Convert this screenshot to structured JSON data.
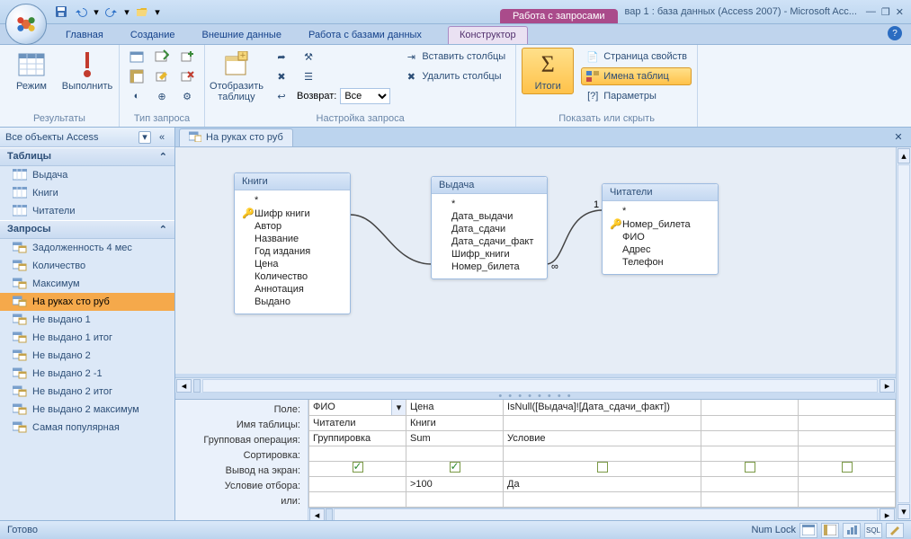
{
  "app": {
    "title": "вар 1 : база данных (Access 2007) - Microsoft Acc...",
    "context_tab": "Работа с запросами"
  },
  "tabs": {
    "home": "Главная",
    "create": "Создание",
    "external": "Внешние данные",
    "dbtools": "Работа с базами данных",
    "designer": "Конструктор"
  },
  "ribbon": {
    "results": {
      "view": "Режим",
      "run": "Выполнить",
      "group": "Результаты"
    },
    "qtype": {
      "group": "Тип запроса"
    },
    "setup": {
      "showtable": "Отобразить\nтаблицу",
      "insert_cols": "Вставить столбцы",
      "delete_cols": "Удалить столбцы",
      "return": "Возврат:",
      "return_val": "Все",
      "group": "Настройка запроса"
    },
    "showhide": {
      "totals": "Итоги",
      "propsheet": "Страница свойств",
      "tablenames": "Имена таблиц",
      "params": "Параметры",
      "group": "Показать или скрыть"
    }
  },
  "nav": {
    "title": "Все объекты Access",
    "group_tables": "Таблицы",
    "tables": [
      "Выдача",
      "Книги",
      "Читатели"
    ],
    "group_queries": "Запросы",
    "queries": [
      "Задолженность 4 мес",
      "Количество",
      "Максимум",
      "На руках сто руб",
      "Не выдано 1",
      "Не выдано 1 итог",
      "Не выдано 2",
      "Не выдано 2 -1",
      "Не выдано 2 итог",
      "Не выдано 2 максимум",
      "Самая популярная"
    ],
    "selected_query": "На руках сто руб"
  },
  "doc": {
    "tab": "На руках сто руб"
  },
  "diagram": {
    "t1": {
      "title": "Книги",
      "fields": [
        "*",
        "Шифр книги",
        "Автор",
        "Название",
        "Год издания",
        "Цена",
        "Количество",
        "Аннотация",
        "Выдано"
      ],
      "key_index": 1
    },
    "t2": {
      "title": "Выдача",
      "fields": [
        "*",
        "Дата_выдачи",
        "Дата_сдачи",
        "Дата_сдачи_факт",
        "Шифр_книги",
        "Номер_билета"
      ]
    },
    "t3": {
      "title": "Читатели",
      "fields": [
        "*",
        "Номер_билета",
        "ФИО",
        "Адрес",
        "Телефон"
      ],
      "key_index": 1
    },
    "rel_one": "1",
    "rel_many": "∞"
  },
  "grid": {
    "labels": {
      "field": "Поле:",
      "table": "Имя таблицы:",
      "total": "Групповая операция:",
      "sort": "Сортировка:",
      "show": "Вывод на экран:",
      "criteria": "Условие отбора:",
      "or": "или:"
    },
    "cols": [
      {
        "field": "ФИО",
        "table": "Читатели",
        "total": "Группировка",
        "show": true,
        "criteria": "",
        "dd": true
      },
      {
        "field": "Цена",
        "table": "Книги",
        "total": "Sum",
        "show": true,
        "criteria": ">100"
      },
      {
        "field": "IsNull([Выдача]![Дата_сдачи_факт])",
        "table": "",
        "total": "Условие",
        "show": false,
        "criteria": "Да",
        "wide": true
      },
      {
        "field": "",
        "table": "",
        "total": "",
        "show": false,
        "criteria": ""
      },
      {
        "field": "",
        "table": "",
        "total": "",
        "show": false,
        "criteria": ""
      }
    ]
  },
  "status": {
    "ready": "Готово",
    "numlock": "Num Lock"
  }
}
